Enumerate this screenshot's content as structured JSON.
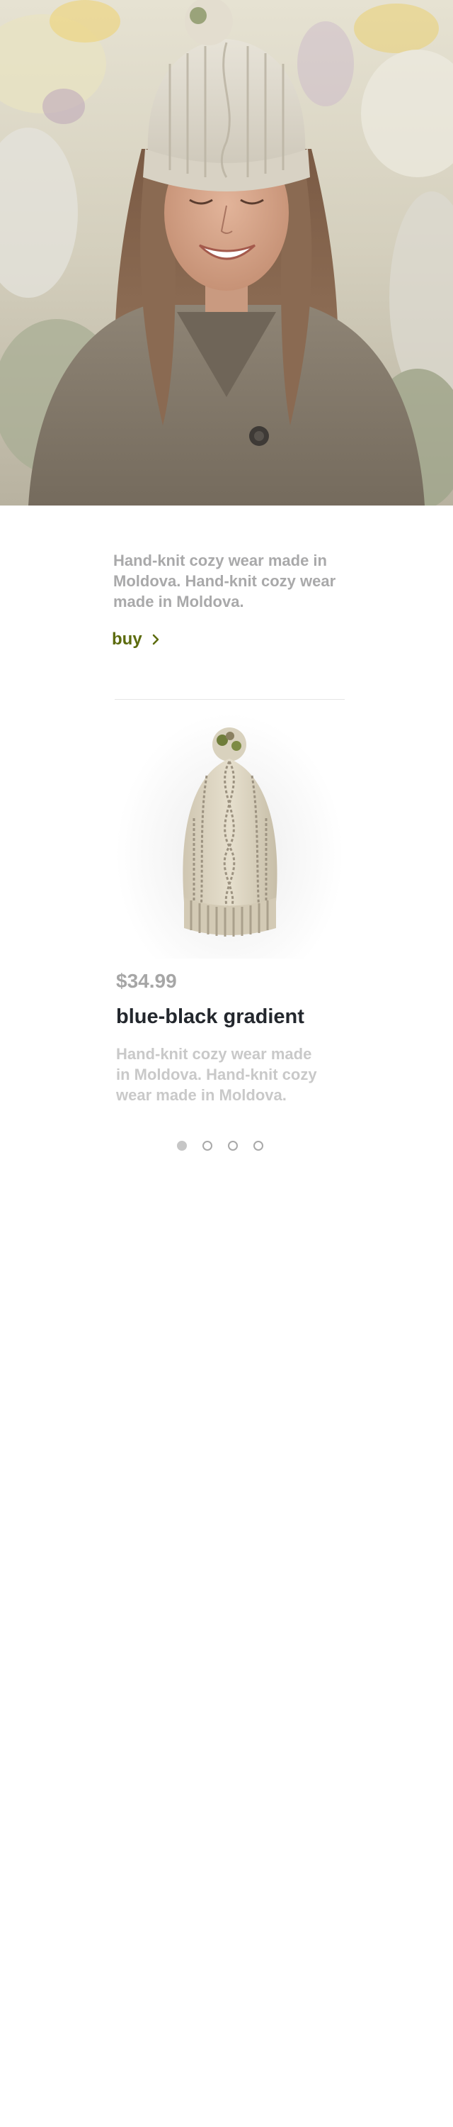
{
  "hero": {
    "image_label": "woman wearing hand-knit hat"
  },
  "intro": {
    "text": "Hand-knit cozy wear made in Moldova. Hand-knit cozy wear made in Moldova.",
    "buy_label": "buy",
    "accent_color": "#5c6b0d"
  },
  "product": {
    "price": "$34.99",
    "name": "blue-black gradient",
    "description": "Hand-knit cozy wear made in Moldova. Hand-knit cozy wear made in Moldova.",
    "image_icon": "knit-beanie-image"
  },
  "pagination": {
    "total": 4,
    "active_index": 0
  }
}
